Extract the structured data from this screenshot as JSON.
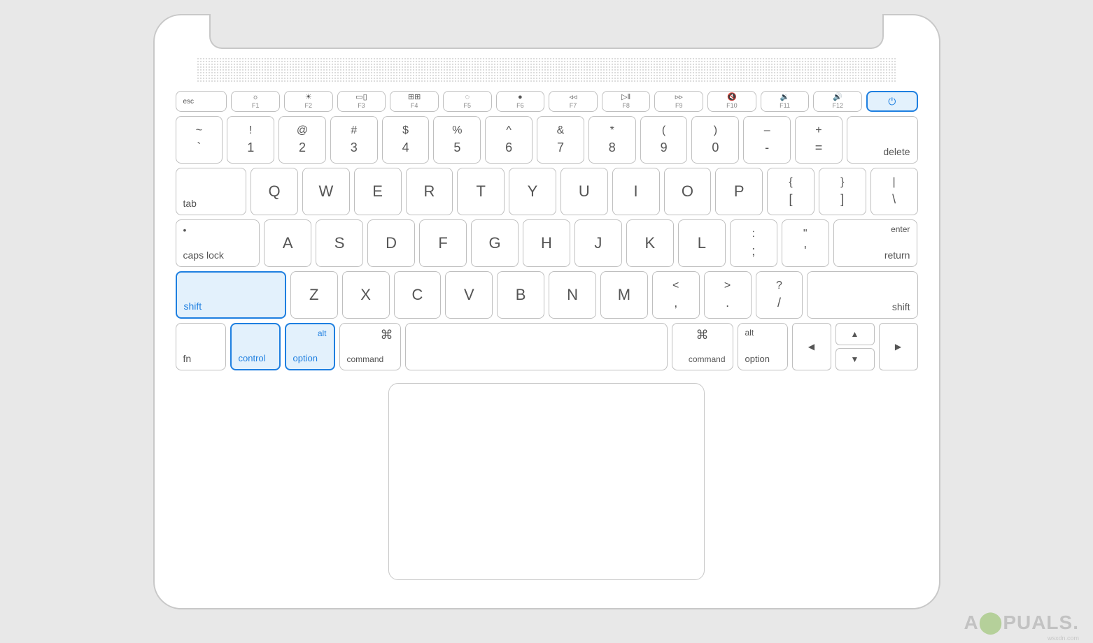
{
  "fnRow": {
    "esc": "esc",
    "keys": [
      {
        "icon": "☼",
        "label": "F1"
      },
      {
        "icon": "☀",
        "label": "F2"
      },
      {
        "icon": "▭▯",
        "label": "F3"
      },
      {
        "icon": "⊞⊞",
        "label": "F4"
      },
      {
        "icon": "◌",
        "label": "F5"
      },
      {
        "icon": "●",
        "label": "F6"
      },
      {
        "icon": "◃◃",
        "label": "F7"
      },
      {
        "icon": "▷‖",
        "label": "F8"
      },
      {
        "icon": "▹▹",
        "label": "F9"
      },
      {
        "icon": "🔇",
        "label": "F10"
      },
      {
        "icon": "🔉",
        "label": "F11"
      },
      {
        "icon": "🔊",
        "label": "F12"
      }
    ],
    "power": "⏻"
  },
  "row1": [
    {
      "top": "~",
      "bot": "`"
    },
    {
      "top": "!",
      "bot": "1"
    },
    {
      "top": "@",
      "bot": "2"
    },
    {
      "top": "#",
      "bot": "3"
    },
    {
      "top": "$",
      "bot": "4"
    },
    {
      "top": "%",
      "bot": "5"
    },
    {
      "top": "^",
      "bot": "6"
    },
    {
      "top": "&",
      "bot": "7"
    },
    {
      "top": "*",
      "bot": "8"
    },
    {
      "top": "(",
      "bot": "9"
    },
    {
      "top": ")",
      "bot": "0"
    },
    {
      "top": "–",
      "bot": "-"
    },
    {
      "top": "+",
      "bot": "="
    }
  ],
  "row1_delete": "delete",
  "row2_tab": "tab",
  "row2": [
    "Q",
    "W",
    "E",
    "R",
    "T",
    "Y",
    "U",
    "I",
    "O",
    "P"
  ],
  "row2_brackets": [
    {
      "top": "{",
      "bot": "["
    },
    {
      "top": "}",
      "bot": "]"
    },
    {
      "top": "|",
      "bot": "\\"
    }
  ],
  "row3_caps_dot": "•",
  "row3_caps": "caps lock",
  "row3": [
    "A",
    "S",
    "D",
    "F",
    "G",
    "H",
    "J",
    "K",
    "L"
  ],
  "row3_punct": [
    {
      "top": ":",
      "bot": ";"
    },
    {
      "top": "\"",
      "bot": "'"
    }
  ],
  "row3_enter_top": "enter",
  "row3_enter_bot": "return",
  "row4_shift_l": "shift",
  "row4": [
    "Z",
    "X",
    "C",
    "V",
    "B",
    "N",
    "M"
  ],
  "row4_punct": [
    {
      "top": "<",
      "bot": ","
    },
    {
      "top": ">",
      "bot": "."
    },
    {
      "top": "?",
      "bot": "/"
    }
  ],
  "row4_shift_r": "shift",
  "row5": {
    "fn": "fn",
    "control": "control",
    "option_alt": "alt",
    "option": "option",
    "command_icon": "⌘",
    "command": "command",
    "arrows": {
      "left": "◀",
      "up": "▲",
      "down": "▼",
      "right": "▶"
    }
  },
  "watermark": {
    "pre": "A",
    "mid": "⬤",
    "post": "PUALS."
  },
  "source": "wsxdn.com"
}
